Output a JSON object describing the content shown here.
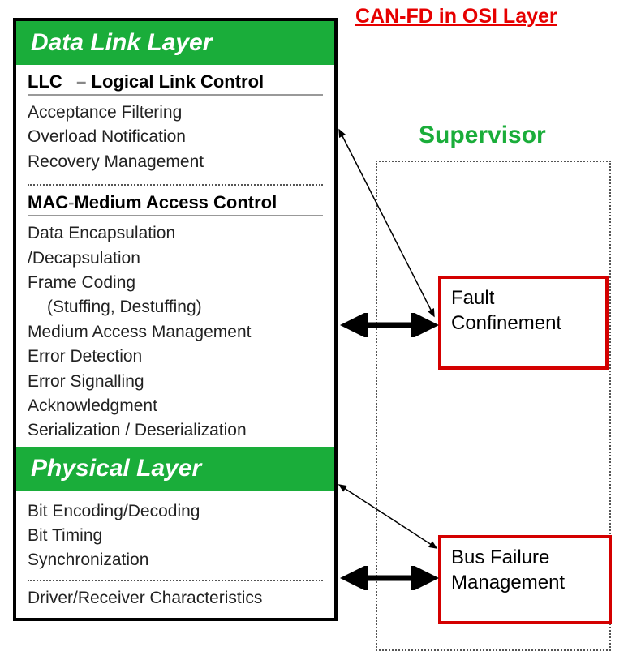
{
  "title": "CAN-FD in OSI Layer",
  "left": {
    "layer1": "Data Link Layer",
    "llc": {
      "abbr": "LLC",
      "dash": "–",
      "full": "Logical Link Control",
      "items": [
        "Acceptance Filtering",
        "Overload Notification",
        "Recovery Management"
      ]
    },
    "mac": {
      "abbr": "MAC",
      "full": "Medium Access Control",
      "items": [
        "Data Encapsulation",
        "/Decapsulation",
        "Frame Coding",
        "(Stuffing, Destuffing)",
        "Medium Access Management",
        "Error Detection",
        "Error Signalling",
        "Acknowledgment",
        "Serialization / Deserialization"
      ],
      "indent_index": 3
    },
    "layer2": "Physical Layer",
    "phys": {
      "items": [
        "Bit Encoding/Decoding",
        "Bit Timing",
        "Synchronization"
      ],
      "extra": "Driver/Receiver Characteristics"
    }
  },
  "supervisor": {
    "label": "Supervisor",
    "fault": "Fault\nConfinement",
    "bus": "Bus Failure\nManagement"
  }
}
